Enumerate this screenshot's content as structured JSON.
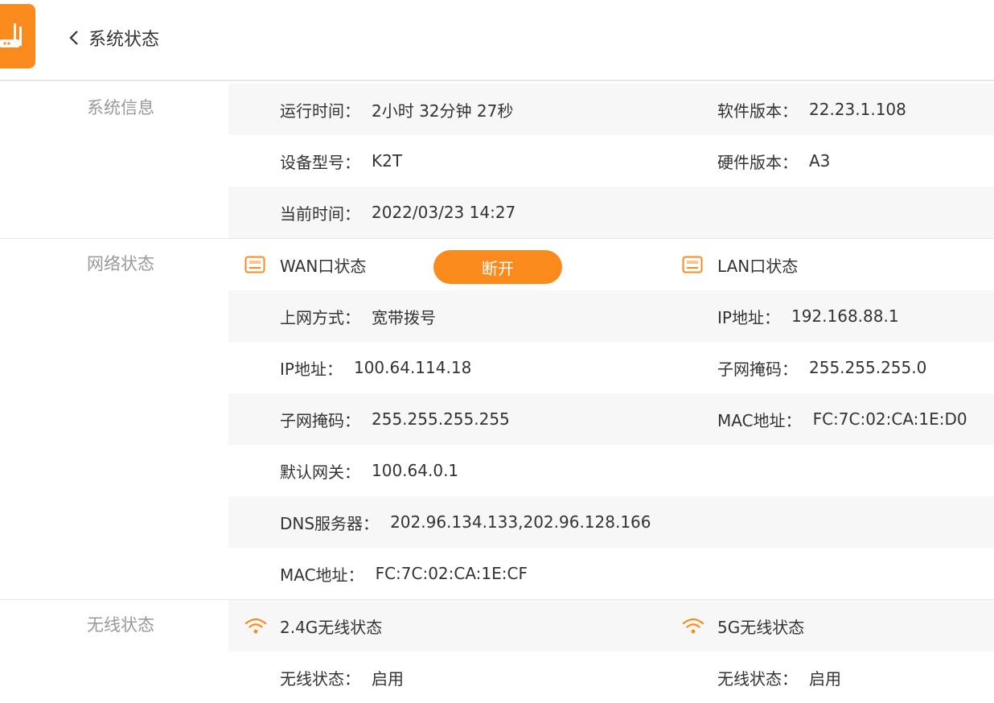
{
  "header": {
    "title": "系统状态",
    "back_icon": "chevron-left-icon",
    "logo_icon": "router-icon",
    "accent": "#fb8a1c"
  },
  "system_info": {
    "label": "系统信息",
    "uptime": {
      "key": "运行时间：",
      "value": "2小时 32分钟 27秒"
    },
    "software_version": {
      "key": "软件版本：",
      "value": "22.23.1.108"
    },
    "device_model": {
      "key": "设备型号：",
      "value": "K2T"
    },
    "hardware_version": {
      "key": "硬件版本：",
      "value": "A3"
    },
    "current_time": {
      "key": "当前时间：",
      "value": "2022/03/23 14:27"
    }
  },
  "network_status": {
    "label": "网络状态",
    "wan": {
      "title": "WAN口状态",
      "icon": "ethernet-port-icon",
      "disconnect_label": "断开",
      "connection_type": {
        "key": "上网方式：",
        "value": "宽带拨号"
      },
      "ip": {
        "key": "IP地址：",
        "value": "100.64.114.18"
      },
      "subnet": {
        "key": "子网掩码：",
        "value": "255.255.255.255"
      },
      "gateway": {
        "key": "默认网关：",
        "value": "100.64.0.1"
      },
      "dns": {
        "key": "DNS服务器：",
        "value": "202.96.134.133,202.96.128.166"
      },
      "mac": {
        "key": "MAC地址：",
        "value": "FC:7C:02:CA:1E:CF"
      }
    },
    "lan": {
      "title": "LAN口状态",
      "icon": "ethernet-port-icon",
      "ip": {
        "key": "IP地址：",
        "value": "192.168.88.1"
      },
      "subnet": {
        "key": "子网掩码：",
        "value": "255.255.255.0"
      },
      "mac": {
        "key": "MAC地址：",
        "value": "FC:7C:02:CA:1E:D0"
      }
    }
  },
  "wireless_status": {
    "label": "无线状态",
    "band_24": {
      "title": "2.4G无线状态",
      "icon": "wifi-icon",
      "state": {
        "key": "无线状态：",
        "value": "启用"
      }
    },
    "band_5": {
      "title": "5G无线状态",
      "icon": "wifi-icon",
      "state": {
        "key": "无线状态：",
        "value": "启用"
      }
    }
  }
}
